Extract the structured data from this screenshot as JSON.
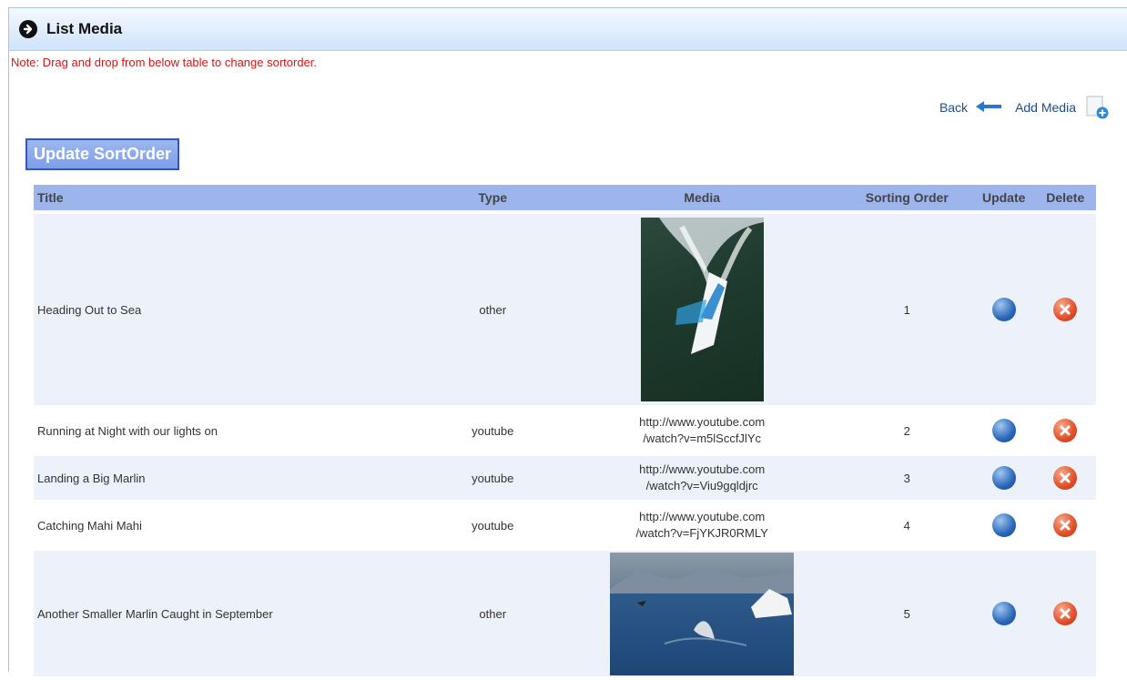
{
  "panel": {
    "title": "List Media"
  },
  "note": "Note: Drag and drop from below table to change sortorder.",
  "links": {
    "back": "Back",
    "add_media": "Add Media"
  },
  "update_sortorder_label": "Update SortOrder",
  "table": {
    "headers": {
      "title": "Title",
      "type": "Type",
      "media": "Media",
      "sorting_order": "Sorting Order",
      "update": "Update",
      "delete": "Delete"
    },
    "rows": [
      {
        "title": "Heading Out to Sea",
        "type": "other",
        "media_kind": "image-boat",
        "order": "1"
      },
      {
        "title": "Running at Night with our lights on",
        "type": "youtube",
        "media_kind": "url",
        "url1": "http://www.youtube.com",
        "url2": "/watch?v=m5lSccfJlYc",
        "order": "2"
      },
      {
        "title": "Landing a Big Marlin",
        "type": "youtube",
        "media_kind": "url",
        "url1": "http://www.youtube.com",
        "url2": "/watch?v=Viu9gqldjrc",
        "order": "3"
      },
      {
        "title": "Catching Mahi Mahi",
        "type": "youtube",
        "media_kind": "url",
        "url1": "http://www.youtube.com",
        "url2": "/watch?v=FjYKJR0RMLY",
        "order": "4"
      },
      {
        "title": "Another Smaller Marlin Caught in September",
        "type": "other",
        "media_kind": "image-marlin",
        "order": "5"
      }
    ]
  },
  "colors": {
    "header_band": "#cfe3fa",
    "note_red": "#d01818",
    "table_header": "#9db5ec",
    "row_alt": "#ecf1fa",
    "button_blue": "#7e9ee8"
  },
  "icons": [
    "arrow-circle-icon",
    "back-arrow-icon",
    "add-media-icon",
    "edit-icon",
    "delete-icon"
  ]
}
